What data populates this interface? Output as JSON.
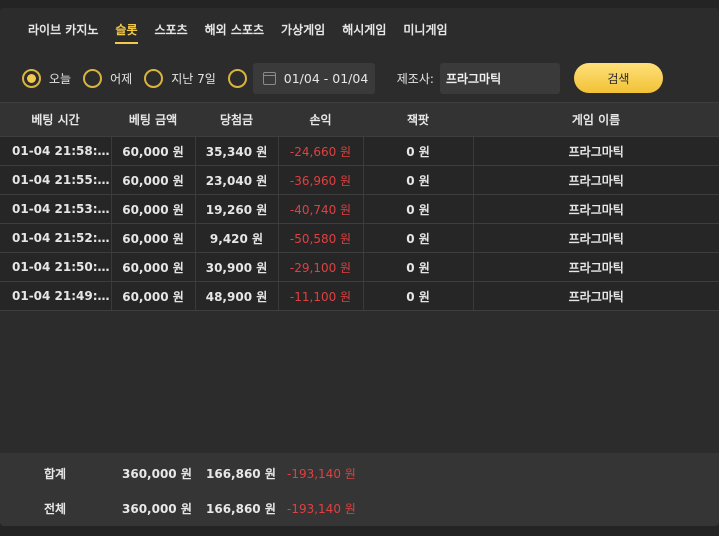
{
  "tabs": [
    {
      "label": "라이브 카지노",
      "active": false
    },
    {
      "label": "슬롯",
      "active": true
    },
    {
      "label": "스포츠",
      "active": false
    },
    {
      "label": "해외 스포츠",
      "active": false
    },
    {
      "label": "가상게임",
      "active": false
    },
    {
      "label": "해시게임",
      "active": false
    },
    {
      "label": "미니게임",
      "active": false
    }
  ],
  "filters": {
    "periods": [
      {
        "label": "오늘",
        "checked": true
      },
      {
        "label": "어제",
        "checked": false
      },
      {
        "label": "지난 7일",
        "checked": false
      },
      {
        "label": "",
        "checked": false
      }
    ],
    "date_range": "01/04 - 01/04",
    "maker_label": "제조사:",
    "maker_value": "프라그마틱",
    "search_label": "검색"
  },
  "table": {
    "columns": [
      "베팅 시간",
      "베팅 금액",
      "당첨금",
      "손익",
      "잭팟",
      "게임 이름"
    ],
    "rows": [
      {
        "time": "01-04 21:58:…",
        "bet": "60,000 원",
        "win": "35,340 원",
        "profit": "-24,660 원",
        "jackpot": "0 원",
        "game": "프라그마틱"
      },
      {
        "time": "01-04 21:55:…",
        "bet": "60,000 원",
        "win": "23,040 원",
        "profit": "-36,960 원",
        "jackpot": "0 원",
        "game": "프라그마틱"
      },
      {
        "time": "01-04 21:53:…",
        "bet": "60,000 원",
        "win": "19,260 원",
        "profit": "-40,740 원",
        "jackpot": "0 원",
        "game": "프라그마틱"
      },
      {
        "time": "01-04 21:52:…",
        "bet": "60,000 원",
        "win": "9,420 원",
        "profit": "-50,580 원",
        "jackpot": "0 원",
        "game": "프라그마틱"
      },
      {
        "time": "01-04 21:50:…",
        "bet": "60,000 원",
        "win": "30,900 원",
        "profit": "-29,100 원",
        "jackpot": "0 원",
        "game": "프라그마틱"
      },
      {
        "time": "01-04 21:49:…",
        "bet": "60,000 원",
        "win": "48,900 원",
        "profit": "-11,100 원",
        "jackpot": "0 원",
        "game": "프라그마틱"
      }
    ]
  },
  "summary": {
    "subtotal": {
      "label": "합계",
      "bet": "360,000 원",
      "win": "166,860 원",
      "profit": "-193,140 원"
    },
    "total": {
      "label": "전체",
      "bet": "360,000 원",
      "win": "166,860 원",
      "profit": "-193,140 원"
    }
  },
  "colors": {
    "accent": "#f2c94c",
    "negative": "#e04040"
  }
}
